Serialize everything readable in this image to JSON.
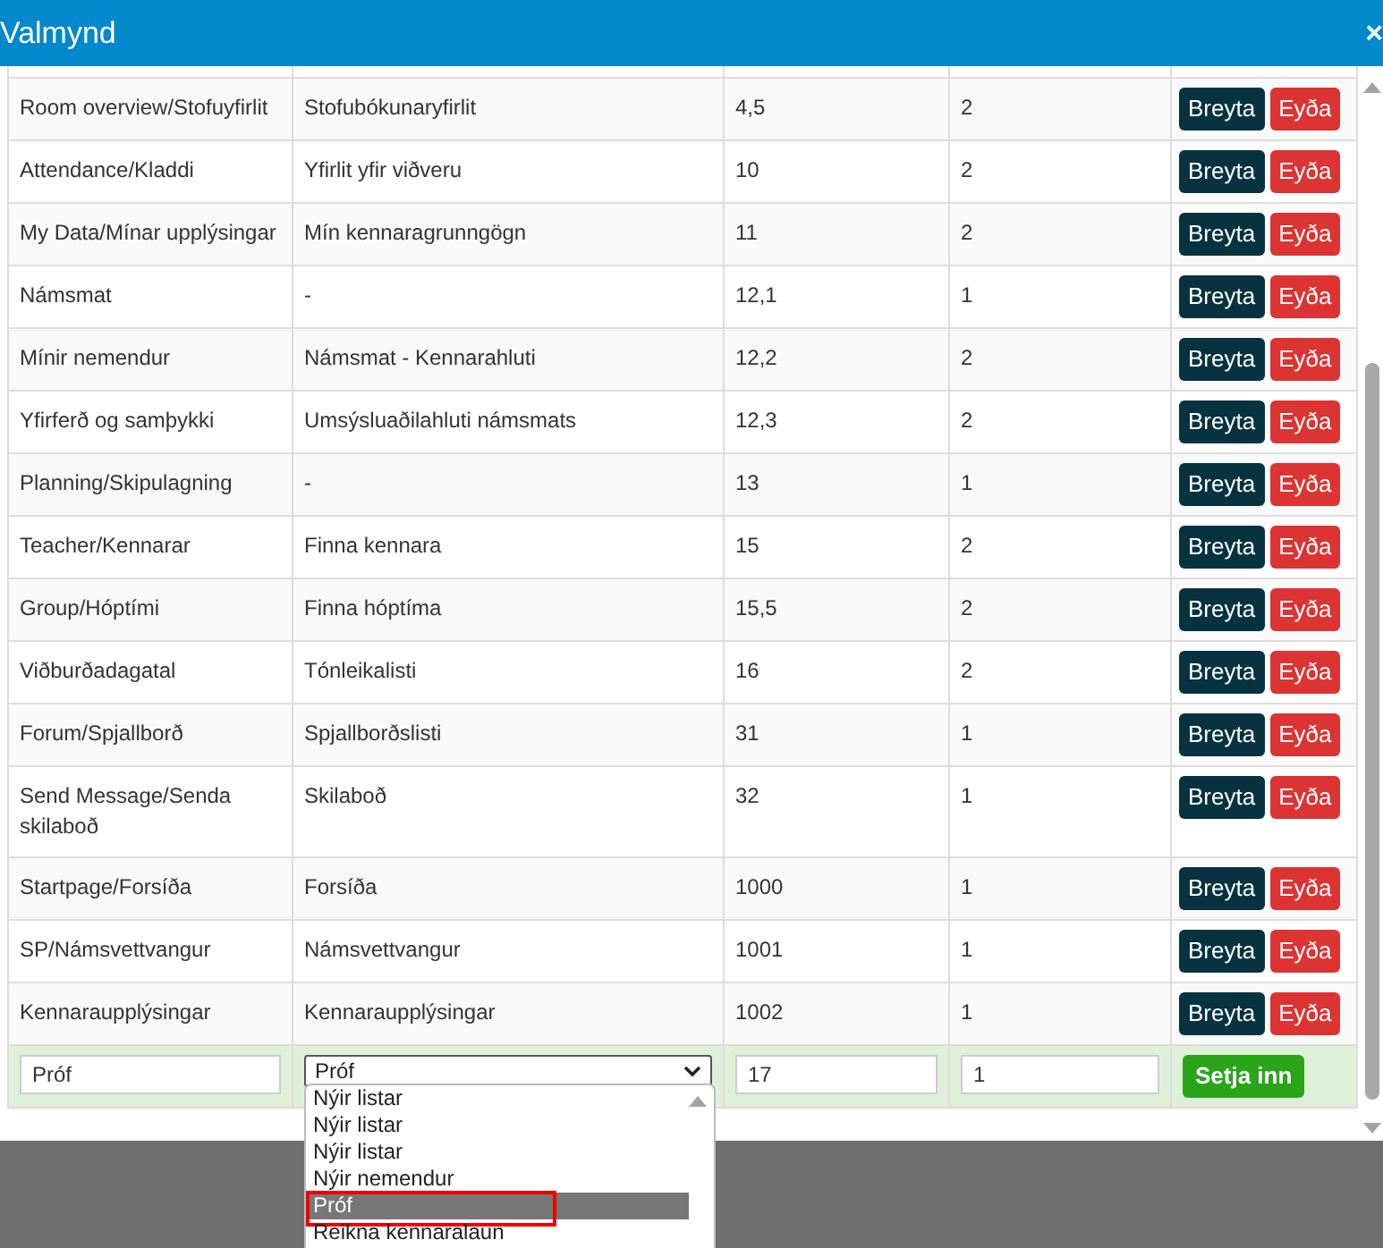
{
  "window": {
    "title": "Valmynd",
    "close": "×"
  },
  "table": {
    "rows": [
      {
        "cells": [
          "Room overview/Stofuyfirlit",
          "Stofubókunaryfirlit",
          "4,5",
          "2"
        ],
        "buttons": [
          {
            "label": "Breyta",
            "kind": "edit"
          },
          {
            "label": "Eyða",
            "kind": "delete"
          }
        ]
      },
      {
        "cells": [
          "Attendance/Kladdi",
          "Yfirlit yfir viðveru",
          "10",
          "2"
        ],
        "buttons": [
          {
            "label": "Breyta",
            "kind": "edit"
          },
          {
            "label": "Eyða",
            "kind": "delete"
          }
        ]
      },
      {
        "cells": [
          "My Data/Mínar upplýsingar",
          "Mín kennaragrunngögn",
          "11",
          "2"
        ],
        "buttons": [
          {
            "label": "Breyta",
            "kind": "edit"
          },
          {
            "label": "Eyða",
            "kind": "delete"
          }
        ]
      },
      {
        "cells": [
          "Námsmat",
          "-",
          "12,1",
          "1"
        ],
        "buttons": [
          {
            "label": "Breyta",
            "kind": "edit"
          },
          {
            "label": "Eyða",
            "kind": "delete"
          }
        ]
      },
      {
        "cells": [
          "Mínir nemendur",
          "Námsmat - Kennarahluti",
          "12,2",
          "2"
        ],
        "buttons": [
          {
            "label": "Breyta",
            "kind": "edit"
          },
          {
            "label": "Eyða",
            "kind": "delete"
          }
        ]
      },
      {
        "cells": [
          "Yfirferð og samþykki",
          "Umsýsluaðilahluti námsmats",
          "12,3",
          "2"
        ],
        "buttons": [
          {
            "label": "Breyta",
            "kind": "edit"
          },
          {
            "label": "Eyða",
            "kind": "delete"
          }
        ]
      },
      {
        "cells": [
          "Planning/Skipulagning",
          "-",
          "13",
          "1"
        ],
        "buttons": [
          {
            "label": "Breyta",
            "kind": "edit"
          },
          {
            "label": "Eyða",
            "kind": "delete"
          }
        ]
      },
      {
        "cells": [
          "Teacher/Kennarar",
          "Finna kennara",
          "15",
          "2"
        ],
        "buttons": [
          {
            "label": "Breyta",
            "kind": "edit"
          },
          {
            "label": "Eyða",
            "kind": "delete"
          }
        ]
      },
      {
        "cells": [
          "Group/Hóptími",
          "Finna hóptíma",
          "15,5",
          "2"
        ],
        "buttons": [
          {
            "label": "Breyta",
            "kind": "edit"
          },
          {
            "label": "Eyða",
            "kind": "delete"
          }
        ]
      },
      {
        "cells": [
          "Viðburðadagatal",
          "Tónleikalisti",
          "16",
          "2"
        ],
        "buttons": [
          {
            "label": "Breyta",
            "kind": "edit"
          },
          {
            "label": "Eyða",
            "kind": "delete"
          }
        ]
      },
      {
        "cells": [
          "Forum/Spjallborð",
          "Spjallborðslisti",
          "31",
          "1"
        ],
        "buttons": [
          {
            "label": "Breyta",
            "kind": "edit"
          },
          {
            "label": "Eyða",
            "kind": "delete"
          }
        ]
      },
      {
        "cells": [
          "Send Message/Senda skilaboð",
          "Skilaboð",
          "32",
          "1"
        ],
        "buttons": [
          {
            "label": "Breyta",
            "kind": "edit"
          },
          {
            "label": "Eyða",
            "kind": "delete"
          }
        ]
      },
      {
        "cells": [
          "Startpage/Forsíða",
          "Forsíða",
          "1000",
          "1"
        ],
        "buttons": [
          {
            "label": "Breyta",
            "kind": "edit"
          },
          {
            "label": "Eyða",
            "kind": "delete"
          }
        ]
      },
      {
        "cells": [
          "SP/Námsvettvangur",
          "Námsvettvangur",
          "1001",
          "1"
        ],
        "buttons": [
          {
            "label": "Breyta",
            "kind": "edit"
          },
          {
            "label": "Eyða",
            "kind": "delete"
          }
        ]
      },
      {
        "cells": [
          "Kennaraupplýsingar",
          "Kennaraupplýsingar",
          "1002",
          "1"
        ],
        "buttons": [
          {
            "label": "Breyta",
            "kind": "edit"
          },
          {
            "label": "Eyða",
            "kind": "delete"
          }
        ]
      }
    ],
    "new_row": {
      "name_field": "Próf",
      "select": {
        "value": "Próf",
        "expanded": true,
        "options": [
          {
            "label": "Nýir listar",
            "selected": false,
            "highlighted": false
          },
          {
            "label": "Nýir listar",
            "selected": false,
            "highlighted": false
          },
          {
            "label": "Nýir listar",
            "selected": false,
            "highlighted": false
          },
          {
            "label": "Nýir nemendur",
            "selected": false,
            "highlighted": false
          },
          {
            "label": "Próf",
            "selected": true,
            "highlighted": true
          },
          {
            "label": "Reikna kennaralaun",
            "selected": false,
            "highlighted": false
          }
        ]
      },
      "order_field": "17",
      "level_field": "1",
      "submit": "Setja inn"
    }
  }
}
